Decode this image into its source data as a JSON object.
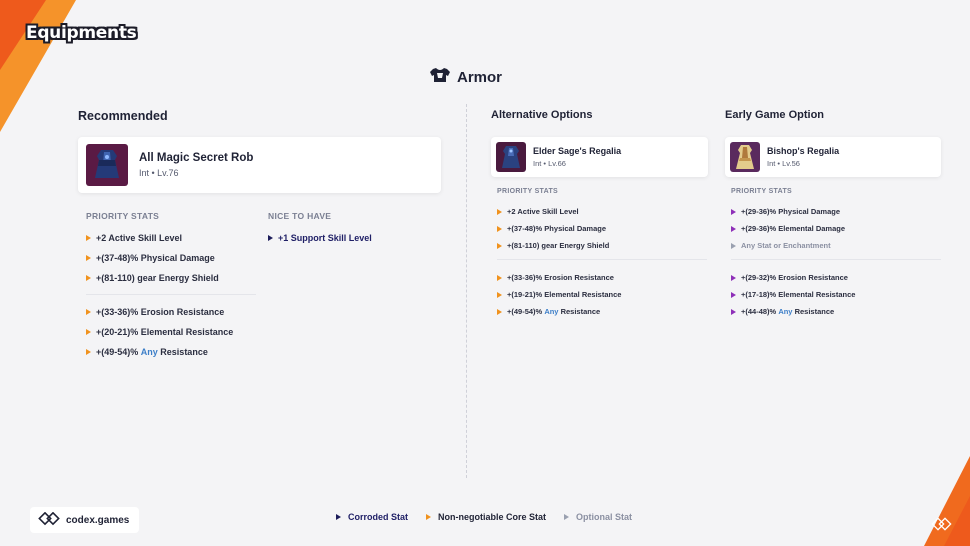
{
  "header": {
    "section_title": "Equipments",
    "slot_title": "Armor"
  },
  "recommended": {
    "heading": "Recommended",
    "item": {
      "name": "All Magic Secret Rob",
      "meta": "Int • Lv.76"
    },
    "priority_label": "PRIORITY STATS",
    "nice_label": "NICE TO HAVE",
    "stats_a": [
      "+2 Active Skill Level",
      "+(37-48)% Physical Damage",
      "+(81-110) gear Energy Shield"
    ],
    "stats_b": [
      {
        "pre": "+(33-36)% Erosion Resistance"
      },
      {
        "pre": "+(20-21)% Elemental Resistance"
      },
      {
        "pre": "+(49-54)% ",
        "any": "Any",
        "post": " Resistance"
      }
    ],
    "nice": [
      "+1 Support Skill Level"
    ]
  },
  "alternative": {
    "heading": "Alternative Options",
    "item": {
      "name": "Elder Sage's Regalia",
      "meta": "Int • Lv.66"
    },
    "priority_label": "PRIORITY STATS",
    "stats_a": [
      "+2 Active Skill Level",
      "+(37-48)% Physical Damage",
      "+(81-110) gear Energy Shield"
    ],
    "stats_b": [
      {
        "pre": "+(33-36)% Erosion Resistance"
      },
      {
        "pre": "+(19-21)% Elemental Resistance"
      },
      {
        "pre": "+(49-54)% ",
        "any": "Any",
        "post": " Resistance"
      }
    ]
  },
  "early": {
    "heading": "Early Game Option",
    "item": {
      "name": "Bishop's Regalia",
      "meta": "Int • Lv.56"
    },
    "priority_label": "PRIORITY STATS",
    "stats_a": [
      "+(29-36)% Physical Damage",
      "+(29-36)% Elemental Damage",
      "Any Stat or Enchantment"
    ],
    "stats_b": [
      {
        "pre": "+(29-32)% Erosion Resistance"
      },
      {
        "pre": "+(17-18)% Elemental Resistance"
      },
      {
        "pre": "+(44-48)% ",
        "any": "Any",
        "post": " Resistance"
      }
    ]
  },
  "footer": {
    "brand": "codex.games",
    "legend": [
      "Corroded Stat",
      "Non-negotiable Core Stat",
      "Optional Stat"
    ]
  },
  "colors": {
    "accent_orange": "#f0921e",
    "corroded": "#1c1c5a",
    "tier_purple": "#8e2fb8",
    "optional_gray": "#9aa0b0",
    "any_blue": "#3c7ec8"
  }
}
